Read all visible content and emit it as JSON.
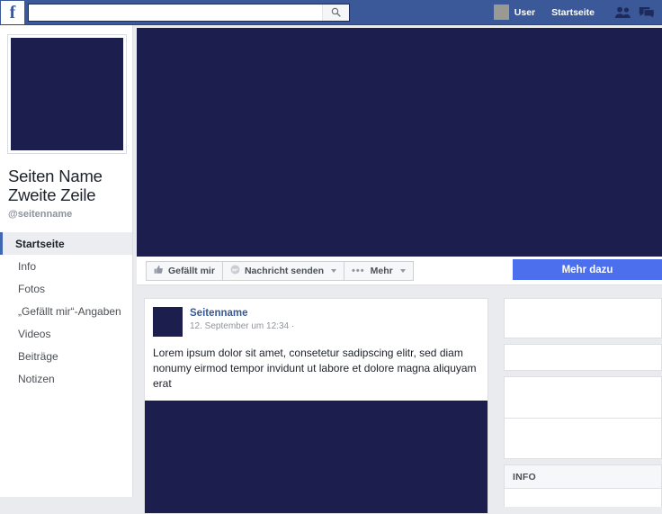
{
  "topbar": {
    "logo": "f",
    "logo_icon": "facebook-logo",
    "search": {
      "value": "",
      "placeholder": "",
      "icon": "search-icon"
    },
    "user": {
      "label": "User",
      "avatar_icon": "user-avatar"
    },
    "home_label": "Startseite",
    "friends_icon": "friends-icon",
    "messages_icon": "messages-icon",
    "background_color": "#3b5998"
  },
  "sidebar": {
    "page_name_line1": "Seiten Name",
    "page_name_line2": "Zweite Zeile",
    "handle": "@seitenname",
    "items": [
      {
        "label": "Startseite",
        "active": true
      },
      {
        "label": "Info",
        "active": false
      },
      {
        "label": "Fotos",
        "active": false
      },
      {
        "label": "„Gefällt mir“-Angaben",
        "active": false
      },
      {
        "label": "Videos",
        "active": false
      },
      {
        "label": "Beiträge",
        "active": false
      },
      {
        "label": "Notizen",
        "active": false
      }
    ],
    "active_accent_color": "#4267b2"
  },
  "cover": {
    "placeholder_color": "#1c1e4e"
  },
  "actionbar": {
    "like_label": "Gefällt mir",
    "like_icon": "thumbs-up-icon",
    "message_label": "Nachricht senden",
    "message_icon": "message-bubble-icon",
    "more_label": "Mehr",
    "more_icon": "ellipsis-icon",
    "cta_label": "Mehr dazu",
    "cta_color": "#4c6fee"
  },
  "post": {
    "author": "Seitenname",
    "timestamp": "12. September um 12:34 ·",
    "body": "Lorem ipsum dolor sit amet, consetetur sadipscing elitr, sed diam nonumy eirmod tempor invidunt ut labore et dolore magna aliquyam erat",
    "avatar_color": "#1c1e4e",
    "image_color": "#1c1e4e"
  },
  "rightcol": {
    "info_heading": "INFO"
  }
}
